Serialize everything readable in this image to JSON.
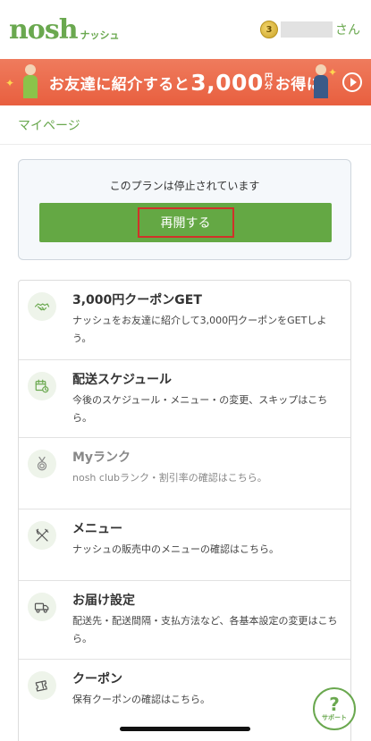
{
  "header": {
    "logo_main": "nosh",
    "logo_sub": "ナッシュ",
    "avatar_glyph": "3",
    "honorific": "さん"
  },
  "banner": {
    "text_1": "お友達に紹介すると",
    "amount": "3,000",
    "unit": "円分",
    "text_2": "お得に",
    "sparkle": "✦"
  },
  "breadcrumb": {
    "label": "マイページ"
  },
  "plan": {
    "status": "このプランは停止されています",
    "resume_label": "再開する"
  },
  "menu": [
    {
      "title": "3,000円クーポンGET",
      "desc": "ナッシュをお友達に紹介して3,000円クーポンをGETしよう。",
      "icon": "handshake-icon"
    },
    {
      "title": "配送スケジュール",
      "desc": "今後のスケジュール・メニュー・の変更、スキップはこちら。",
      "icon": "calendar-clock-icon"
    },
    {
      "title": "Myランク",
      "desc": "nosh clubランク・割引率の確認はこちら。",
      "icon": "medal-icon"
    },
    {
      "title": "メニュー",
      "desc": "ナッシュの販売中のメニューの確認はこちら。",
      "icon": "fork-knife-icon"
    },
    {
      "title": "お届け設定",
      "desc": "配送先・配送間隔・支払方法など、各基本設定の変更はこちら。",
      "icon": "truck-icon"
    },
    {
      "title": "クーポン",
      "desc": "保有クーポンの確認はこちら。",
      "icon": "ticket-icon"
    }
  ],
  "support": {
    "glyph": "?",
    "label": "サポート"
  },
  "colors": {
    "brand_green": "#6aa84f",
    "button_green": "#64a844",
    "banner_orange": "#e85f3f",
    "highlight_red": "#d0322a"
  }
}
